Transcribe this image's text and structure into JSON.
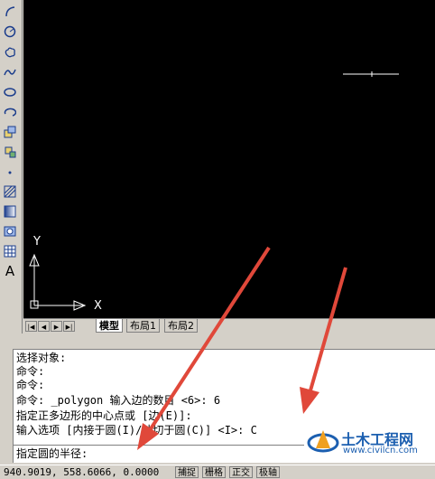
{
  "toolbar": {
    "icons": [
      "arc-icon",
      "circle-icon",
      "revcloud-icon",
      "spline-icon",
      "ellipse-icon",
      "ellipse-arc-icon",
      "insert-block-icon",
      "make-block-icon",
      "point-icon",
      "hatch-icon",
      "gradient-icon",
      "region-icon",
      "table-icon",
      "multiline-text-icon"
    ],
    "text_tool_label": "A"
  },
  "canvas": {
    "background": "#000000",
    "y_axis_label": "Y",
    "x_axis_label": "X"
  },
  "tabs": {
    "nav": [
      "|◀",
      "◀",
      "▶",
      "▶|"
    ],
    "items": [
      {
        "label": "模型",
        "active": true
      },
      {
        "label": "布局1",
        "active": false
      },
      {
        "label": "布局2",
        "active": false
      }
    ]
  },
  "command": {
    "history": [
      "选择对象:",
      "命令:",
      "命令:",
      "命令: _polygon 输入边的数目 <6>: 6",
      "指定正多边形的中心点或 [边(E)]:",
      "输入选项 [内接于圆(I)/外切于圆(C)] <I>: C"
    ],
    "prompt": "指定圆的半径:"
  },
  "status": {
    "coords": "940.9019, 558.6066, 0.0000",
    "buttons": [
      "捕捉",
      "栅格",
      "正交",
      "极轴"
    ]
  },
  "watermark": {
    "name": "土木工程网",
    "url": "www.civilcn.com",
    "accent": "#1c5fb0"
  },
  "annotation_color": "#e0483a"
}
